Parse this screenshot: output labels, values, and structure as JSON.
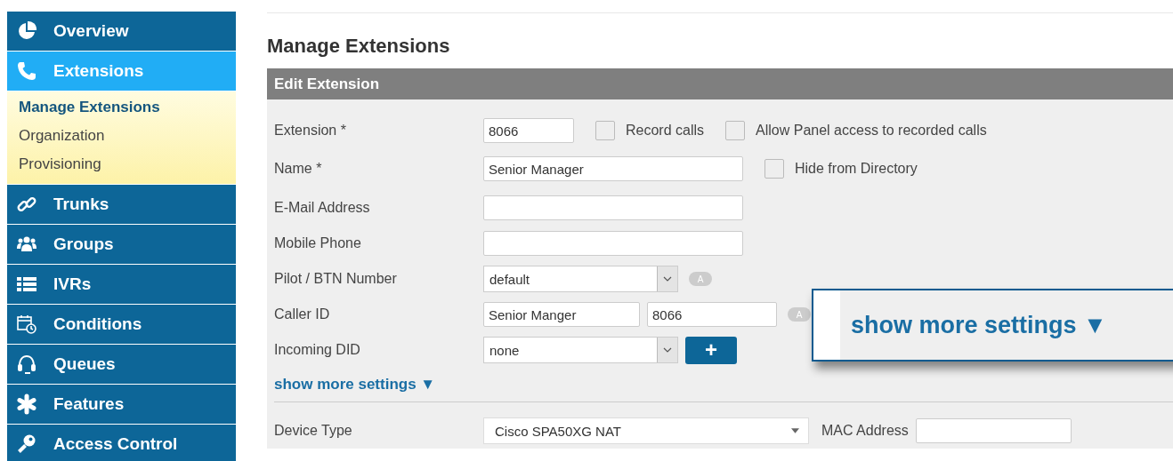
{
  "sidebar": {
    "items": [
      {
        "label": "Overview",
        "selected": false
      },
      {
        "label": "Extensions",
        "selected": true,
        "children": [
          {
            "label": "Manage Extensions",
            "selected": true
          },
          {
            "label": "Organization",
            "selected": false
          },
          {
            "label": "Provisioning",
            "selected": false
          }
        ]
      },
      {
        "label": "Trunks",
        "selected": false
      },
      {
        "label": "Groups",
        "selected": false
      },
      {
        "label": "IVRs",
        "selected": false
      },
      {
        "label": "Conditions",
        "selected": false
      },
      {
        "label": "Queues",
        "selected": false
      },
      {
        "label": "Features",
        "selected": false
      },
      {
        "label": "Access Control",
        "selected": false
      }
    ]
  },
  "page_title": "Manage Extensions",
  "panel": {
    "title": "Edit Extension",
    "extension": {
      "label": "Extension *",
      "value": "8066"
    },
    "record_calls": {
      "label": "Record calls",
      "checked": false
    },
    "allow_panel_access": {
      "label": "Allow Panel access to recorded calls",
      "checked": false
    },
    "name": {
      "label": "Name *",
      "value": "Senior Manager"
    },
    "hide_from_directory": {
      "label": "Hide from Directory",
      "checked": false
    },
    "email": {
      "label": "E-Mail Address"
    },
    "mobile": {
      "label": "Mobile Phone"
    },
    "pilot": {
      "label": "Pilot / BTN Number",
      "value": "default",
      "badge": "A"
    },
    "caller_id": {
      "label": "Caller ID",
      "name": "Senior Manger",
      "number": "8066",
      "badge": "A"
    },
    "incoming_did": {
      "label": "Incoming DID",
      "value": "none",
      "button": "+"
    },
    "show_more": "show more settings ▼",
    "device_type": {
      "label": "Device Type",
      "value": "Cisco SPA50XG NAT"
    },
    "mac_address": {
      "label": "MAC Address"
    }
  },
  "callout": {
    "text": "show more settings ▼"
  }
}
